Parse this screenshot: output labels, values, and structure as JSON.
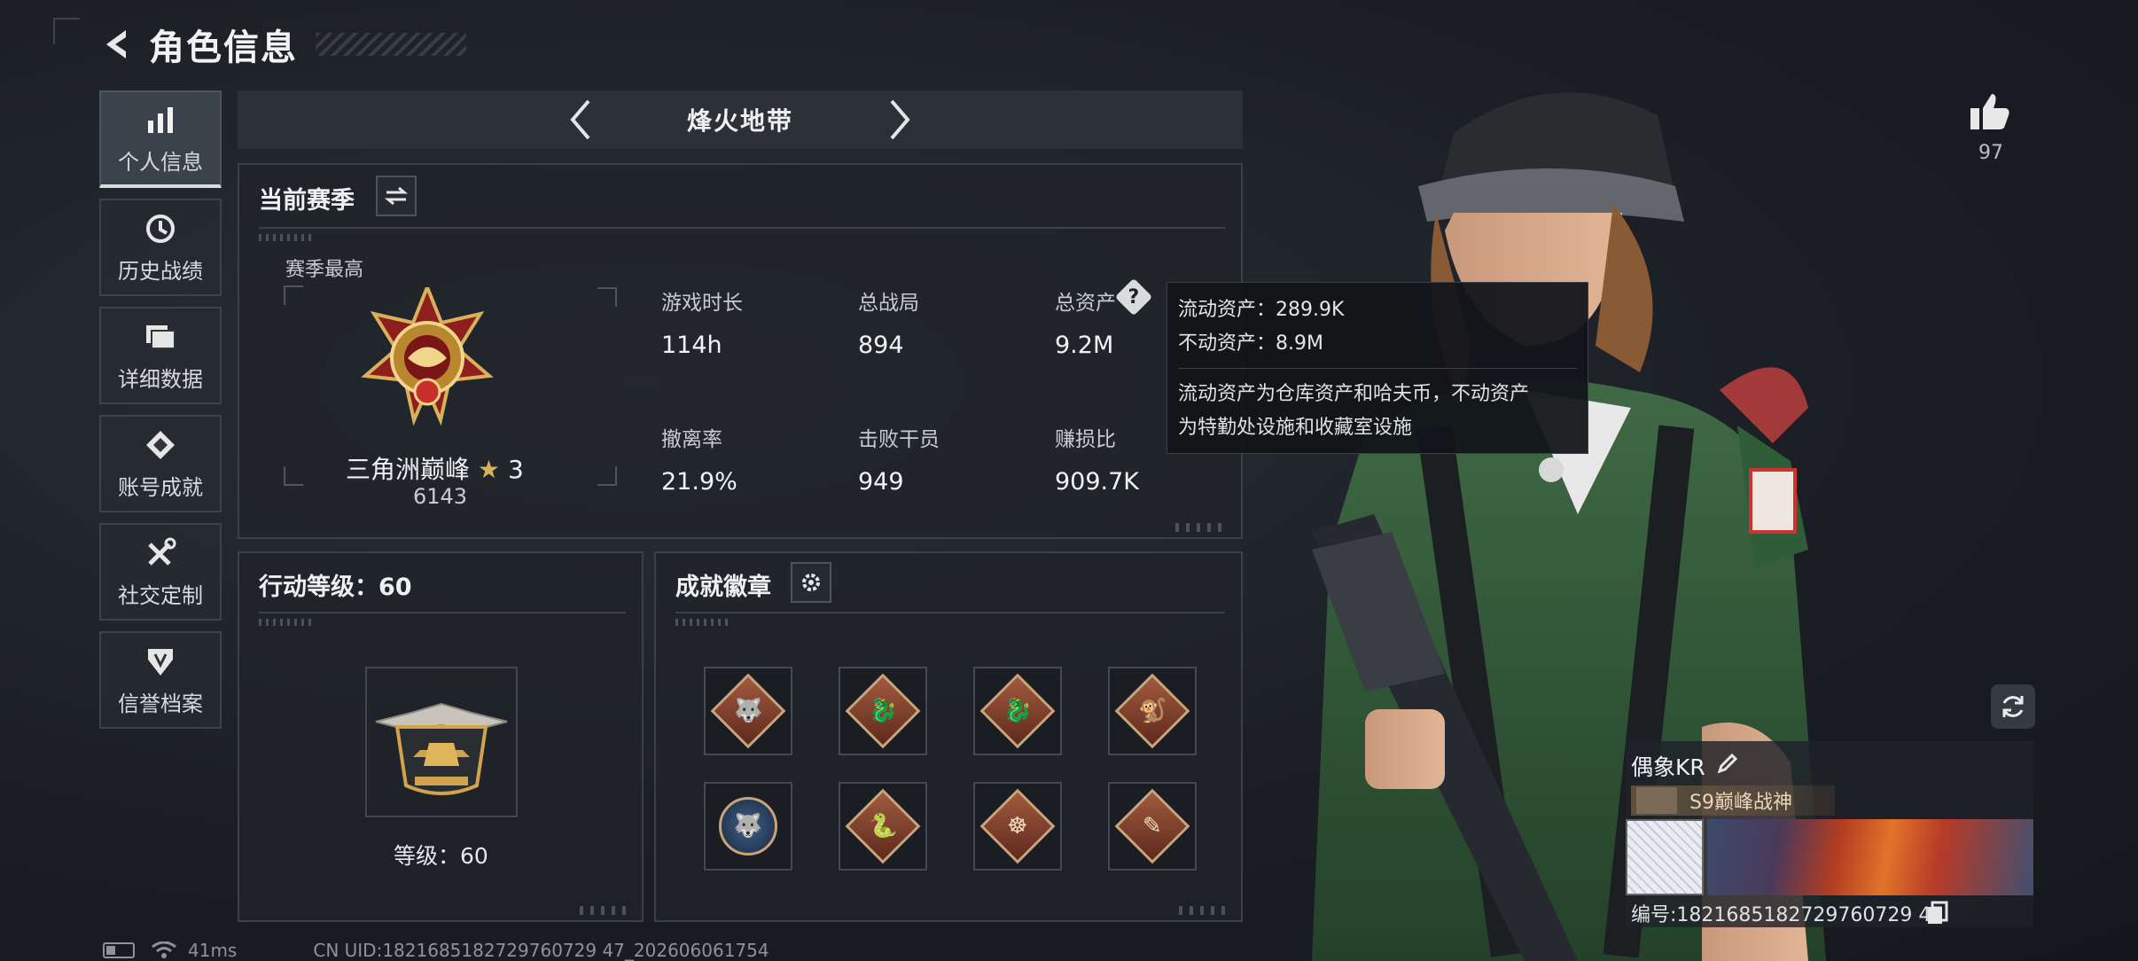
{
  "header": {
    "title": "角色信息"
  },
  "sidebar": {
    "items": [
      {
        "label": "个人信息",
        "icon": "bar-chart-icon",
        "active": true
      },
      {
        "label": "历史战绩",
        "icon": "history-icon"
      },
      {
        "label": "详细数据",
        "icon": "folder-icon"
      },
      {
        "label": "账号成就",
        "icon": "achievement-icon"
      },
      {
        "label": "社交定制",
        "icon": "tools-icon"
      },
      {
        "label": "信誉档案",
        "icon": "shield-icon"
      }
    ]
  },
  "map_nav": {
    "current": "烽火地带"
  },
  "season": {
    "title": "当前赛季",
    "best_label": "赛季最高",
    "rank_name": "三角洲巅峰",
    "rank_stars": "3",
    "rank_points": "6143",
    "stats": [
      {
        "label": "游戏时长",
        "value": "114h"
      },
      {
        "label": "总战局",
        "value": "894"
      },
      {
        "label": "总资产",
        "value": "9.2M"
      },
      {
        "label": "撤离率",
        "value": "21.9%"
      },
      {
        "label": "击败干员",
        "value": "949"
      },
      {
        "label": "赚损比",
        "value": "909.7K"
      }
    ],
    "help_glyph": "?"
  },
  "tooltip": {
    "liquid": "流动资产：289.9K",
    "fixed": "不动资产：8.9M",
    "desc_line1": "流动资产为仓库资产和哈夫币，不动资产",
    "desc_line2": "为特勤处设施和收藏室设施"
  },
  "action_level": {
    "title": "行动等级：60",
    "level_label": "等级：60"
  },
  "achievements": {
    "title": "成就徽章",
    "medals": [
      {
        "glyph": "🐺",
        "style": "diamond"
      },
      {
        "glyph": "🐉",
        "style": "diamond"
      },
      {
        "glyph": "🐉",
        "style": "diamond"
      },
      {
        "glyph": "🐒",
        "style": "diamond"
      },
      {
        "glyph": "🐺",
        "style": "round"
      },
      {
        "glyph": "🐍",
        "style": "diamond"
      },
      {
        "glyph": "☸",
        "style": "diamond"
      },
      {
        "glyph": "✎",
        "style": "diamond"
      }
    ]
  },
  "likes": {
    "count": "97"
  },
  "profile_card": {
    "name": "偶象KR",
    "title_tag": "S9巅峰战神",
    "number": "编号:1821685182729760729 47"
  },
  "footer": {
    "ping": "41ms",
    "uid": "CN UID:1821685182729760729 47_202606061754"
  },
  "colors": {
    "accent": "#d9dde1",
    "panel_border": "#39414b",
    "tooltip_bg": "#121418"
  }
}
